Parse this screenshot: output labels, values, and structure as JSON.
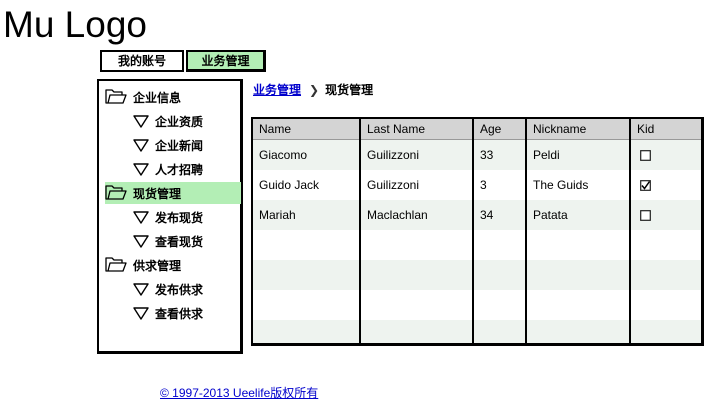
{
  "logo": "Mu Logo",
  "tabs": [
    {
      "label": "我的账号",
      "active": false
    },
    {
      "label": "业务管理",
      "active": true
    }
  ],
  "nav": [
    {
      "label": "企业信息",
      "type": "folder"
    },
    {
      "label": "企业资质",
      "type": "child"
    },
    {
      "label": "企业新闻",
      "type": "child"
    },
    {
      "label": "人才招聘",
      "type": "child"
    },
    {
      "label": "现货管理",
      "type": "folder",
      "selected": true
    },
    {
      "label": "发布现货",
      "type": "child"
    },
    {
      "label": "查看现货",
      "type": "child"
    },
    {
      "label": "供求管理",
      "type": "folder"
    },
    {
      "label": "发布供求",
      "type": "child"
    },
    {
      "label": "查看供求",
      "type": "child"
    }
  ],
  "breadcrumb": {
    "parent": "业务管理",
    "current": "现货管理"
  },
  "table": {
    "columns": [
      "Name",
      "Last Name",
      "Age",
      "Nickname",
      "Kid"
    ],
    "rows": [
      {
        "name": "Giacomo",
        "last_name": "Guilizzoni",
        "age": "33",
        "nickname": "Peldi",
        "kid": false
      },
      {
        "name": "Guido Jack",
        "last_name": "Guilizzoni",
        "age": "3",
        "nickname": "The Guids",
        "kid": true
      },
      {
        "name": "Mariah",
        "last_name": "Maclachlan",
        "age": "34",
        "nickname": "Patata",
        "kid": false
      }
    ]
  },
  "footer": "© 1997-2013 Ueelife版权所有",
  "colors": {
    "accent_green": "#b3eeb5",
    "link_blue": "#0000cc",
    "header_gray": "#d4d4d4",
    "row_alt": "#eef3ef"
  }
}
